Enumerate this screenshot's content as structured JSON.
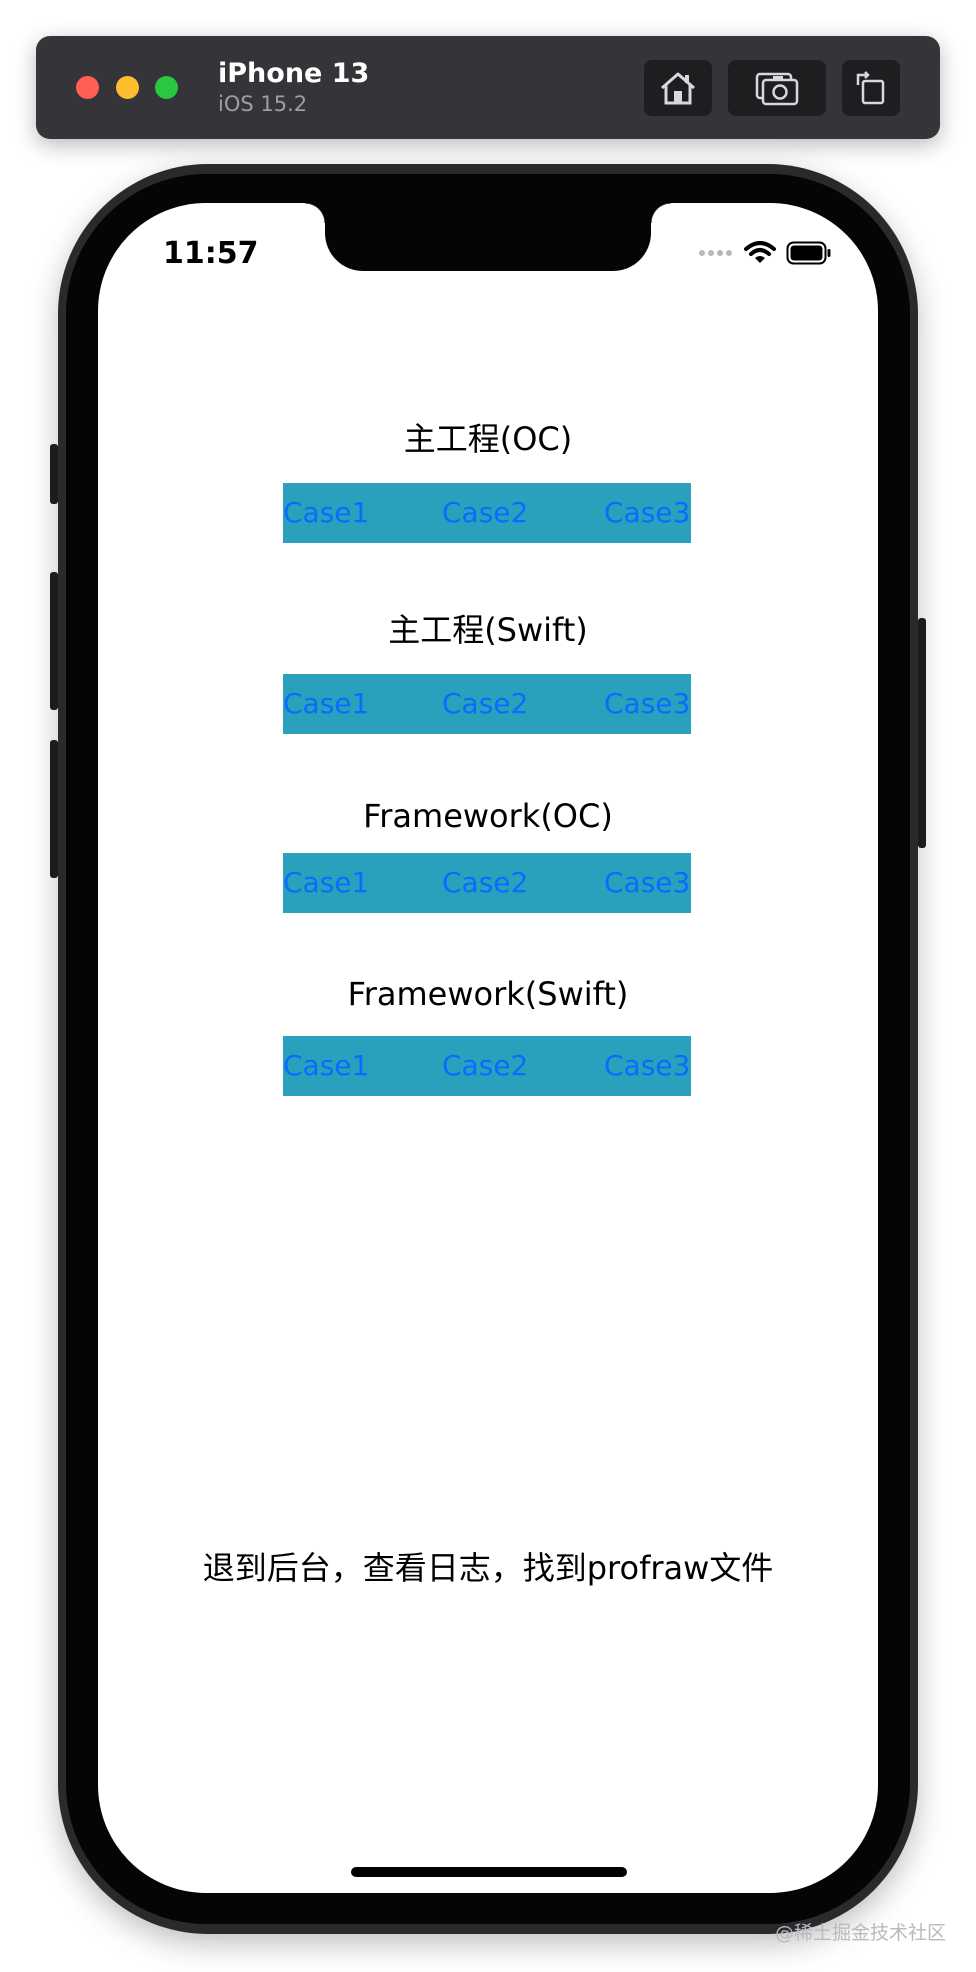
{
  "simulator": {
    "device_name": "iPhone 13",
    "os_version": "iOS 15.2"
  },
  "status_bar": {
    "time": "11:57"
  },
  "sections": [
    {
      "title": "主工程(OC)",
      "buttons": [
        "Case1",
        "Case2",
        "Case3"
      ]
    },
    {
      "title": "主工程(Swift)",
      "buttons": [
        "Case1",
        "Case2",
        "Case3"
      ]
    },
    {
      "title": "Framework(OC)",
      "buttons": [
        "Case1",
        "Case2",
        "Case3"
      ]
    },
    {
      "title": "Framework(Swift)",
      "buttons": [
        "Case1",
        "Case2",
        "Case3"
      ]
    }
  ],
  "footer": {
    "instruction": "退到后台，查看日志，找到profraw文件"
  },
  "watermark": "@稀土掘金技术社区",
  "colors": {
    "button_bar": "#2ba0bc",
    "button_text": "#0a6cff"
  }
}
